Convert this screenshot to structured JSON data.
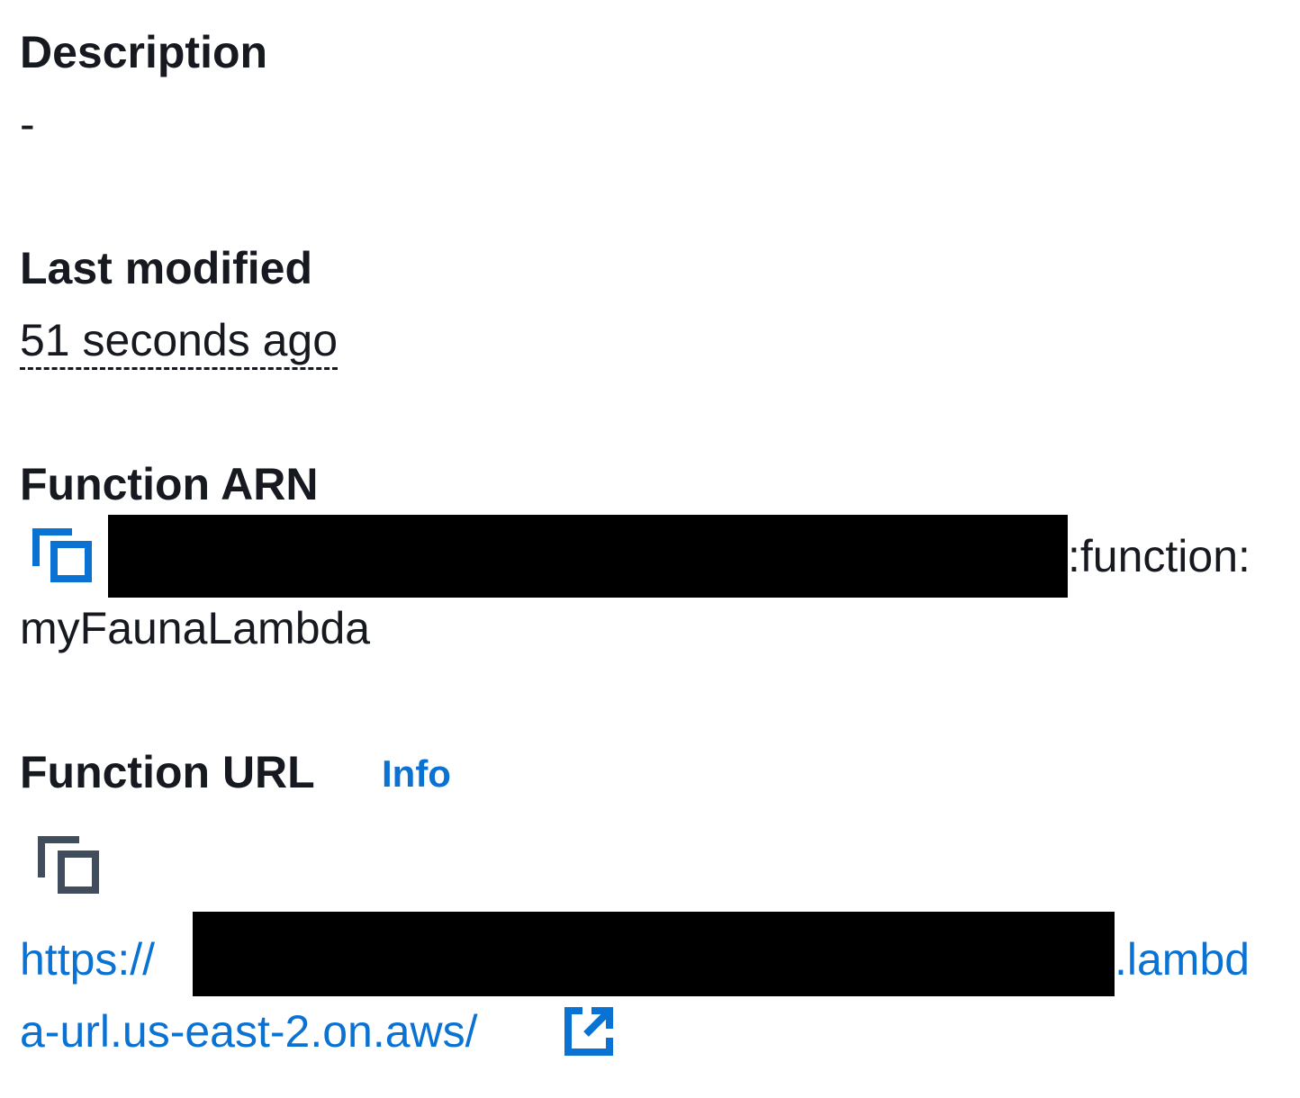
{
  "description": {
    "label": "Description",
    "value": "-"
  },
  "last_modified": {
    "label": "Last modified",
    "value": "51 seconds ago"
  },
  "function_arn": {
    "label": "Function ARN",
    "value_suffix": ":function:",
    "value_line2": "myFaunaLambda",
    "copy_icon": "copy-icon"
  },
  "function_url": {
    "label": "Function URL",
    "info_link": "Info",
    "copy_icon": "copy-icon",
    "url_prefix": "https://",
    "url_suffix": ".lambd",
    "url_line2": "a-url.us-east-2.on.aws/",
    "external_icon": "external-link-icon"
  },
  "colors": {
    "link": "#0972d3",
    "text": "#16191f",
    "copy_icon_arn": "#0972d3",
    "copy_icon_url": "#414d5c",
    "redaction": "#000000"
  }
}
